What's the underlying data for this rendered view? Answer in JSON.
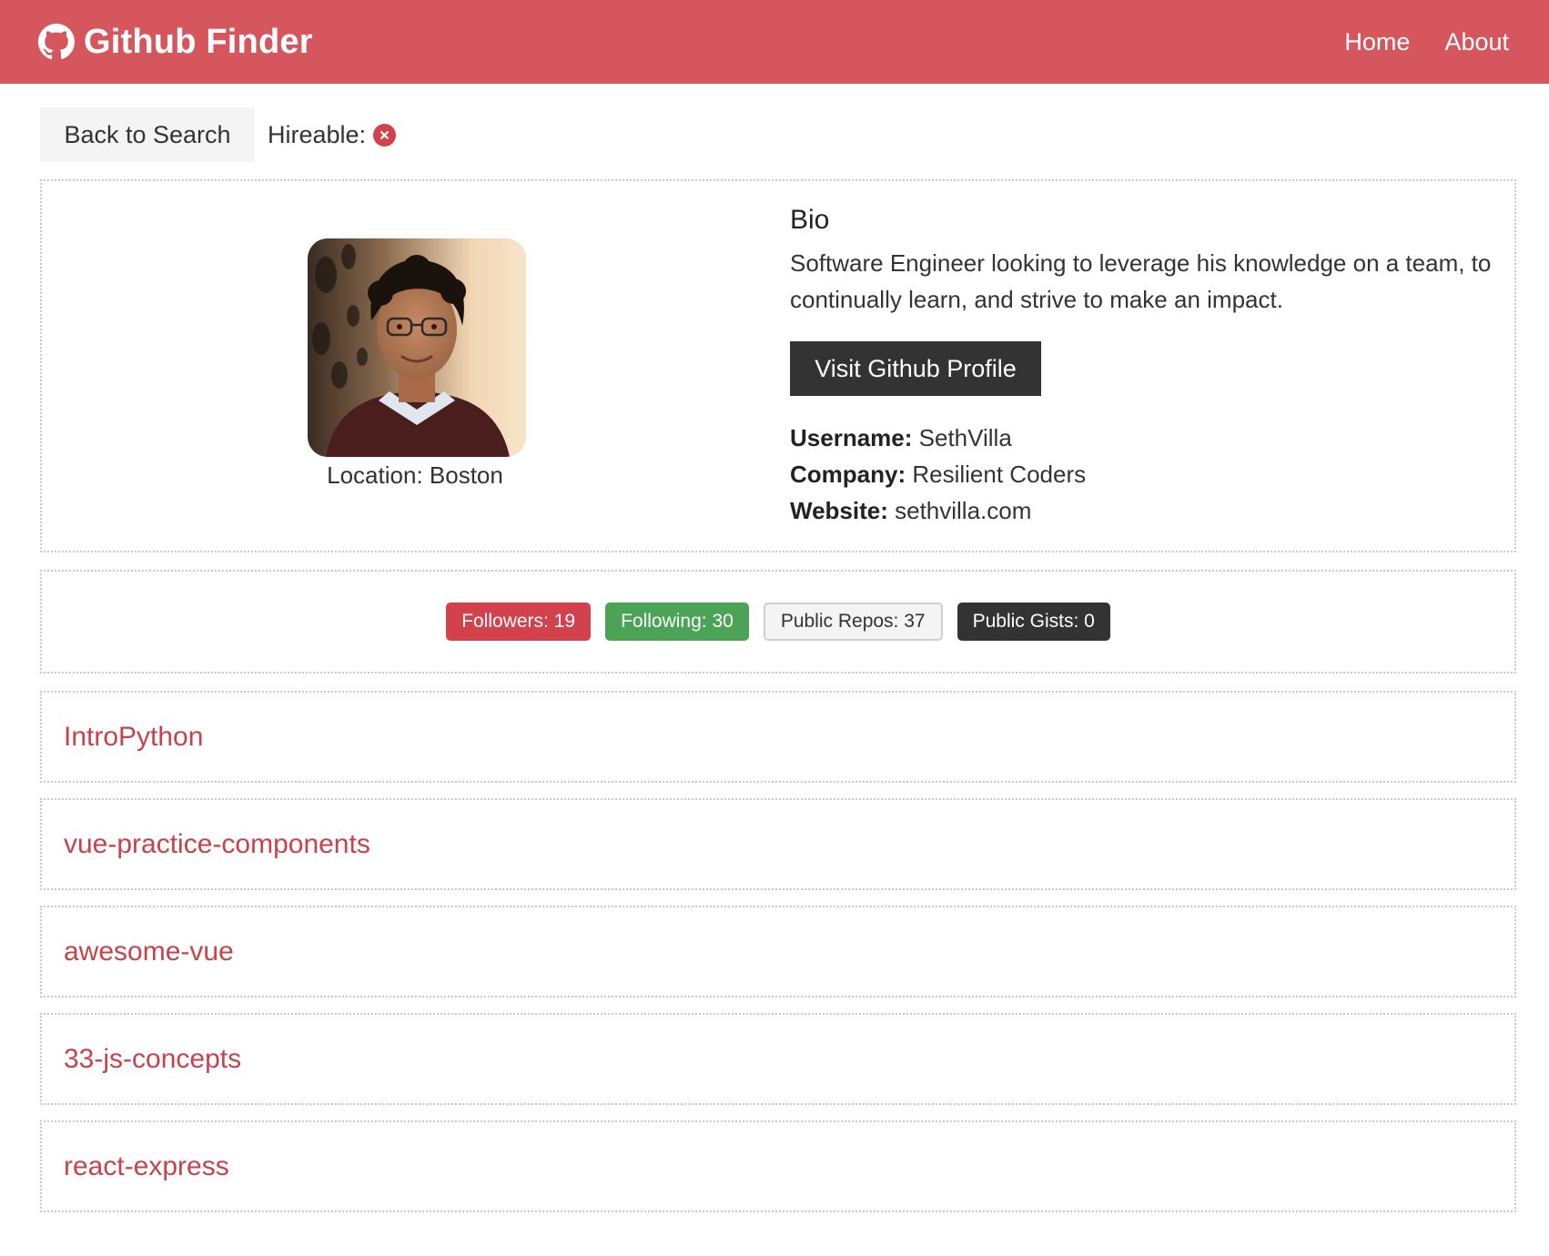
{
  "navbar": {
    "title": "Github Finder",
    "brand_icon": "github-icon",
    "links": [
      "Home",
      "About"
    ]
  },
  "actions": {
    "back_label": "Back to Search",
    "hireable_label": "Hireable:",
    "hireable_icon": "times-circle-icon"
  },
  "profile": {
    "location_label": "Location: Boston",
    "bio_heading": "Bio",
    "bio": "Software Engineer looking to leverage his knowledge on a team, to continually learn, and strive to make an impact.",
    "visit_label": "Visit Github Profile",
    "username_label": "Username:",
    "username": "SethVilla",
    "company_label": "Company:",
    "company": "Resilient Coders",
    "website_label": "Website:",
    "website": "sethvilla.com"
  },
  "stats": {
    "followers": "Followers: 19",
    "following": "Following: 30",
    "public_repos": "Public Repos: 37",
    "public_gists": "Public Gists: 0"
  },
  "repos": [
    "IntroPython",
    "vue-practice-components",
    "awesome-vue",
    "33-js-concepts",
    "react-express"
  ],
  "colors": {
    "navbar": "#d5575d",
    "primary_red": "#d3414d",
    "success_green": "#4ba356",
    "dark": "#333333",
    "light": "#f4f4f4"
  }
}
